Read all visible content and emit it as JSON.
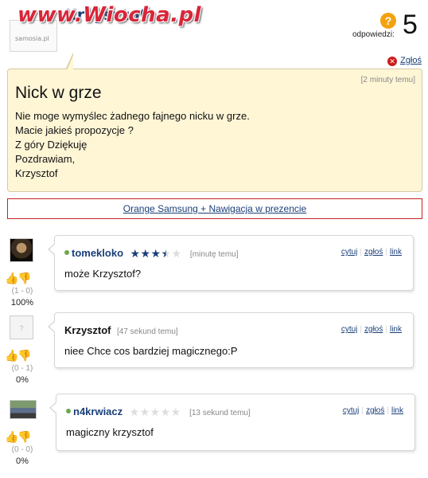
{
  "header": {
    "author": "Krzysztof",
    "watermark": "www.Wiocha.pl",
    "avatar_logo": "samosia.pl",
    "answers_label": "odpowiedzi:",
    "answers_count": "5",
    "report_label": "Zgłoś"
  },
  "question": {
    "time": "[2 minuty temu]",
    "title": "Nick w grze",
    "lines": [
      "Nie moge wymyślec żadnego fajnego nicku w grze.",
      "Macie jakieś propozycje ?",
      "Z góry Dziękuję",
      "Pozdrawiam,",
      "Krzysztof"
    ]
  },
  "ad": {
    "label": "Orange Samsung + Nawigacja w prezencie"
  },
  "answers": [
    {
      "user": "tomekloko",
      "online": true,
      "rating": 3.5,
      "time": "[minutę temu]",
      "text": "może Krzysztof?",
      "votes": "(1 - 0)",
      "percent": "100%",
      "actions": {
        "quote": "cytuj",
        "report": "zgłoś",
        "link": "link"
      }
    },
    {
      "user": "Krzysztof",
      "online": false,
      "rating": null,
      "time": "[47 sekund temu]",
      "text": "niee Chce cos bardziej magicznego:P",
      "votes": "(0 - 1)",
      "percent": "0%",
      "actions": {
        "quote": "cytuj",
        "report": "zgłoś",
        "link": "link"
      }
    },
    {
      "user": "n4krwiacz",
      "online": true,
      "rating": 0,
      "time": "[13 sekund temu]",
      "text": "magiczny krzysztof",
      "votes": "(0 - 0)",
      "percent": "0%",
      "actions": {
        "quote": "cytuj",
        "report": "zgłoś",
        "link": "link"
      }
    }
  ],
  "icons": {
    "answers": "question-bubble-icon",
    "report": "close-circle-icon",
    "thumb_up": "thumb-up-icon",
    "thumb_down": "thumb-down-icon",
    "star": "star-icon"
  },
  "colors": {
    "accent": "#1a3f78",
    "question_bg": "#fff6d6",
    "watermark": "#d8263a",
    "ad_border": "#c92020",
    "online": "#6aa84f"
  }
}
